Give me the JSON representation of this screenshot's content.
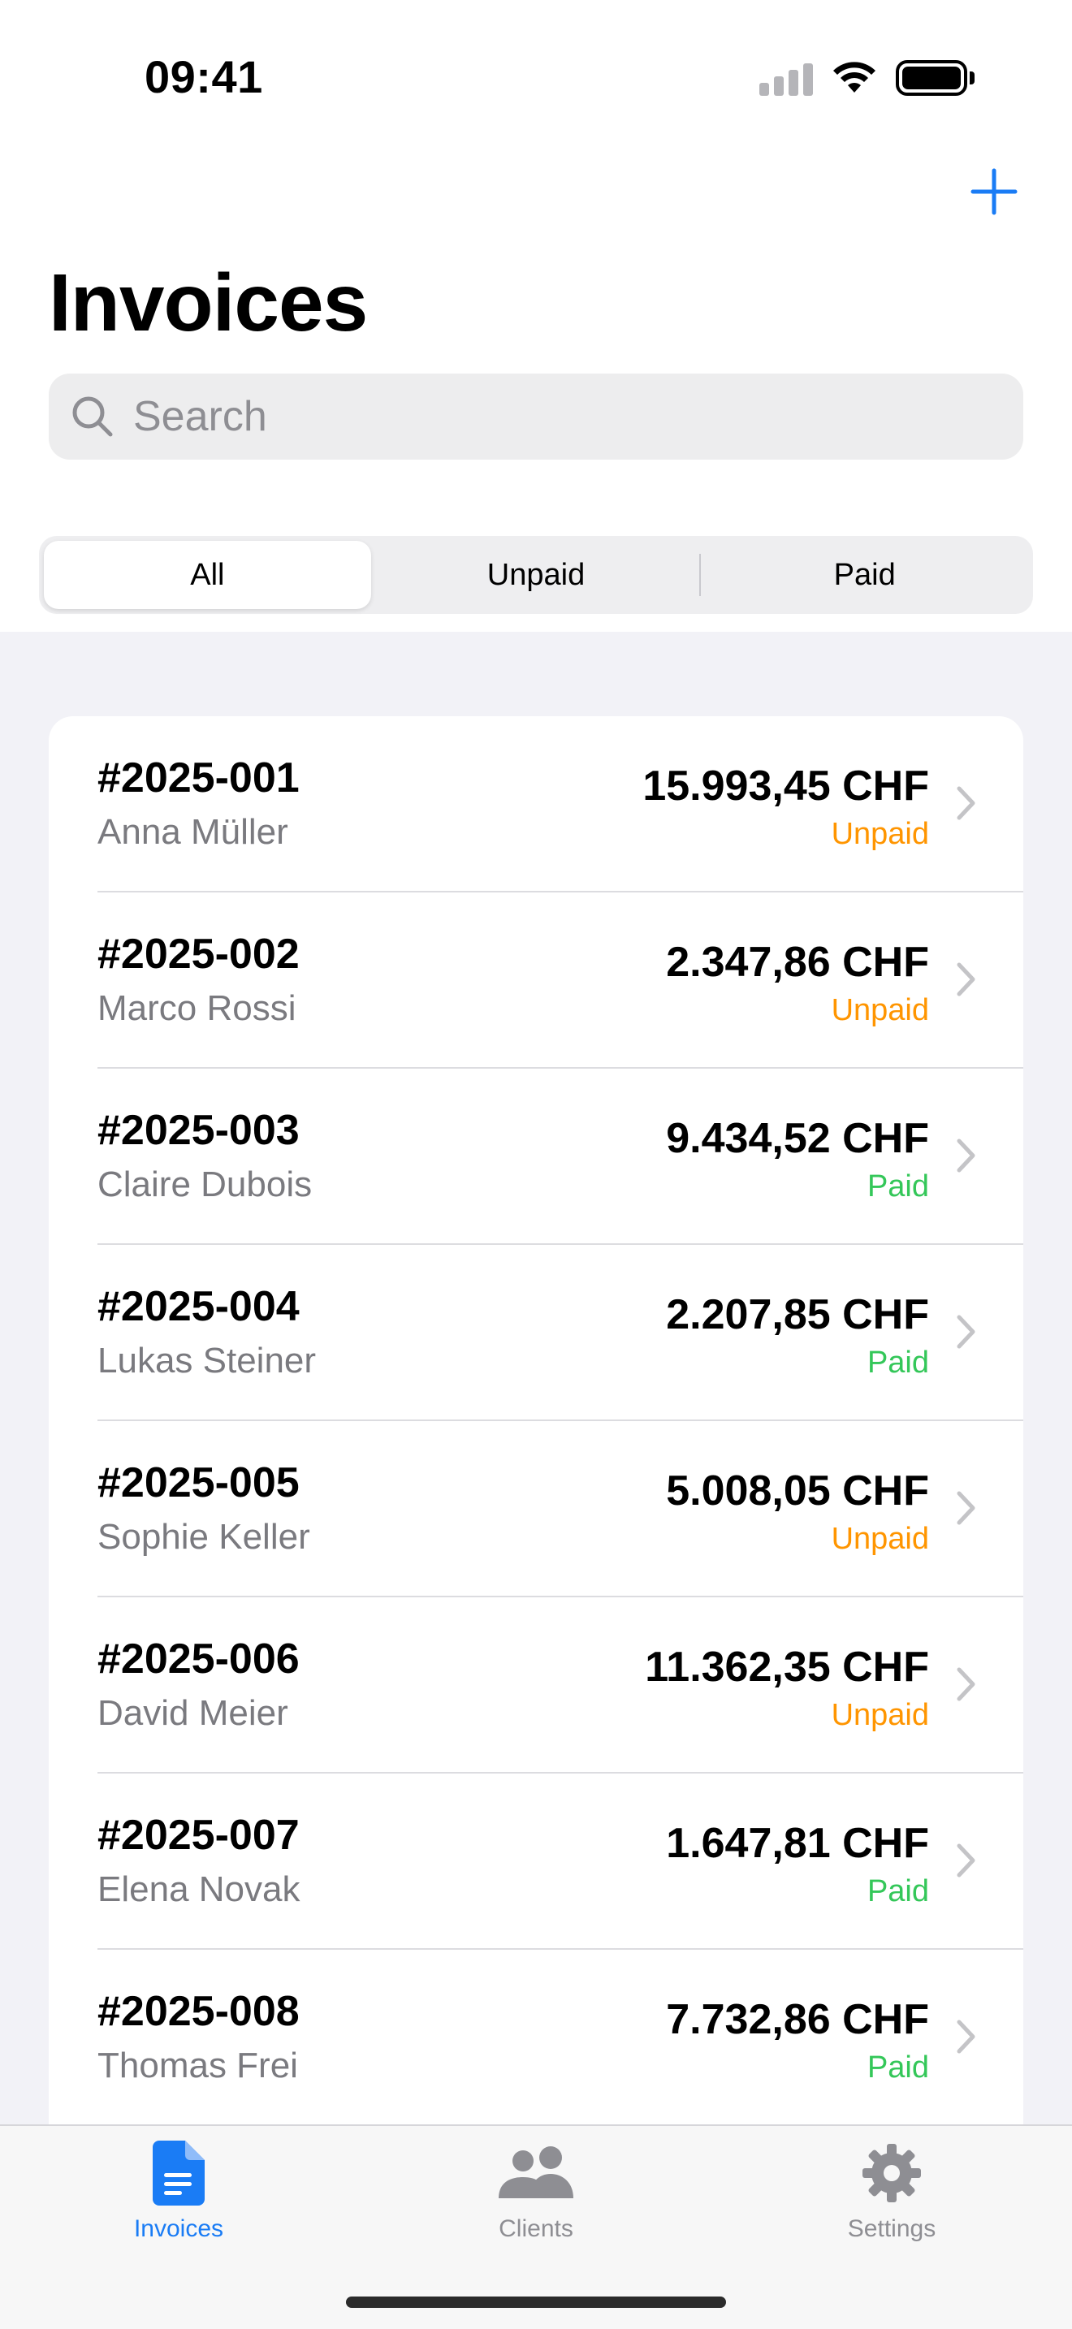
{
  "status_bar": {
    "time": "09:41"
  },
  "header": {
    "title": "Invoices"
  },
  "search": {
    "placeholder": "Search"
  },
  "filter": {
    "segments": [
      "All",
      "Unpaid",
      "Paid"
    ],
    "selected": "All"
  },
  "invoices": [
    {
      "number": "#2025-001",
      "client": "Anna Müller",
      "amount": "15.993,45 CHF",
      "status": "Unpaid"
    },
    {
      "number": "#2025-002",
      "client": "Marco Rossi",
      "amount": "2.347,86 CHF",
      "status": "Unpaid"
    },
    {
      "number": "#2025-003",
      "client": "Claire Dubois",
      "amount": "9.434,52 CHF",
      "status": "Paid"
    },
    {
      "number": "#2025-004",
      "client": "Lukas Steiner",
      "amount": "2.207,85 CHF",
      "status": "Paid"
    },
    {
      "number": "#2025-005",
      "client": "Sophie Keller",
      "amount": "5.008,05 CHF",
      "status": "Unpaid"
    },
    {
      "number": "#2025-006",
      "client": "David Meier",
      "amount": "11.362,35 CHF",
      "status": "Unpaid"
    },
    {
      "number": "#2025-007",
      "client": "Elena Novak",
      "amount": "1.647,81 CHF",
      "status": "Paid"
    },
    {
      "number": "#2025-008",
      "client": "Thomas Frei",
      "amount": "7.732,86 CHF",
      "status": "Paid"
    }
  ],
  "tab_bar": {
    "tabs": [
      {
        "label": "Invoices",
        "icon": "document-icon",
        "active": true
      },
      {
        "label": "Clients",
        "icon": "people-icon",
        "active": false
      },
      {
        "label": "Settings",
        "icon": "gear-icon",
        "active": false
      }
    ]
  },
  "colors": {
    "accent": "#1a7cf5",
    "unpaid": "#ff9500",
    "paid": "#34c759"
  }
}
